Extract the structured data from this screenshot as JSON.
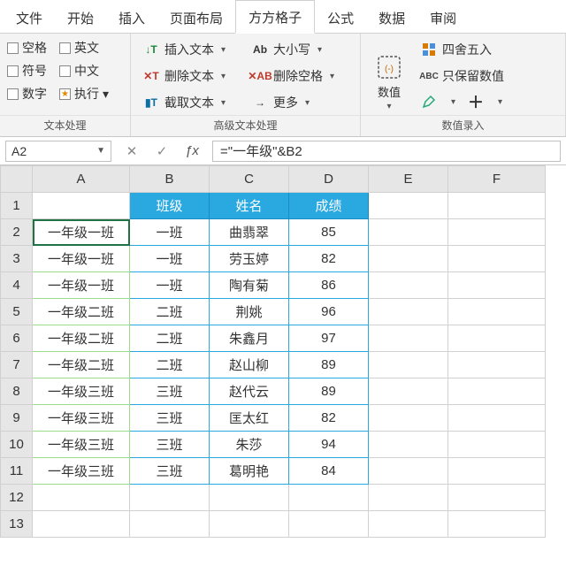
{
  "menu": {
    "tabs": [
      "文件",
      "开始",
      "插入",
      "页面布局",
      "方方格子",
      "公式",
      "数据",
      "审阅"
    ],
    "active_index": 4
  },
  "ribbon": {
    "group1": {
      "title": "文本处理",
      "opts": [
        {
          "label": "空格",
          "checked": false
        },
        {
          "label": "英文",
          "checked": false
        },
        {
          "label": "符号",
          "checked": false
        },
        {
          "label": "中文",
          "checked": false
        },
        {
          "label": "数字",
          "checked": false
        },
        {
          "label": "执行",
          "checked": false,
          "star": true
        }
      ]
    },
    "group2": {
      "title": "高级文本处理",
      "col1": [
        {
          "icon": "↓T",
          "cls": "green",
          "label": "插入文本"
        },
        {
          "icon": "✕T",
          "cls": "red",
          "label": "删除文本"
        },
        {
          "icon": "▮T",
          "cls": "blue",
          "label": "截取文本"
        }
      ],
      "col2": [
        {
          "icon": "Ab",
          "cls": "",
          "label": "大小写"
        },
        {
          "icon": "✕AB",
          "cls": "red",
          "label": "删除空格"
        },
        {
          "icon": "→",
          "cls": "",
          "label": "更多"
        }
      ]
    },
    "group3": {
      "title": "数值录入",
      "big": {
        "label": "数值"
      },
      "side": [
        {
          "label": "四舍五入"
        },
        {
          "label": "只保留数值"
        },
        {
          "label": ""
        }
      ]
    }
  },
  "formula_bar": {
    "name_box": "A2",
    "formula": "=\"一年级\"&B2"
  },
  "sheet": {
    "cols": [
      "A",
      "B",
      "C",
      "D",
      "E",
      "F"
    ],
    "header_row": [
      "",
      "班级",
      "姓名",
      "成绩"
    ],
    "rows": [
      {
        "n": 1,
        "a": "",
        "b": "",
        "c": "",
        "d": "",
        "hdr": true
      },
      {
        "n": 2,
        "a": "一年级一班",
        "b": "一班",
        "c": "曲翡翠",
        "d": "85"
      },
      {
        "n": 3,
        "a": "一年级一班",
        "b": "一班",
        "c": "劳玉婷",
        "d": "82"
      },
      {
        "n": 4,
        "a": "一年级一班",
        "b": "一班",
        "c": "陶有菊",
        "d": "86"
      },
      {
        "n": 5,
        "a": "一年级二班",
        "b": "二班",
        "c": "荆姚",
        "d": "96"
      },
      {
        "n": 6,
        "a": "一年级二班",
        "b": "二班",
        "c": "朱鑫月",
        "d": "97"
      },
      {
        "n": 7,
        "a": "一年级二班",
        "b": "二班",
        "c": "赵山柳",
        "d": "89"
      },
      {
        "n": 8,
        "a": "一年级三班",
        "b": "三班",
        "c": "赵代云",
        "d": "89"
      },
      {
        "n": 9,
        "a": "一年级三班",
        "b": "三班",
        "c": "匡太红",
        "d": "82"
      },
      {
        "n": 10,
        "a": "一年级三班",
        "b": "三班",
        "c": "朱莎",
        "d": "94"
      },
      {
        "n": 11,
        "a": "一年级三班",
        "b": "三班",
        "c": "葛明艳",
        "d": "84"
      },
      {
        "n": 12,
        "a": "",
        "b": "",
        "c": "",
        "d": ""
      },
      {
        "n": 13,
        "a": "",
        "b": "",
        "c": "",
        "d": ""
      }
    ],
    "selected": {
      "row": 2,
      "col": "A"
    }
  }
}
